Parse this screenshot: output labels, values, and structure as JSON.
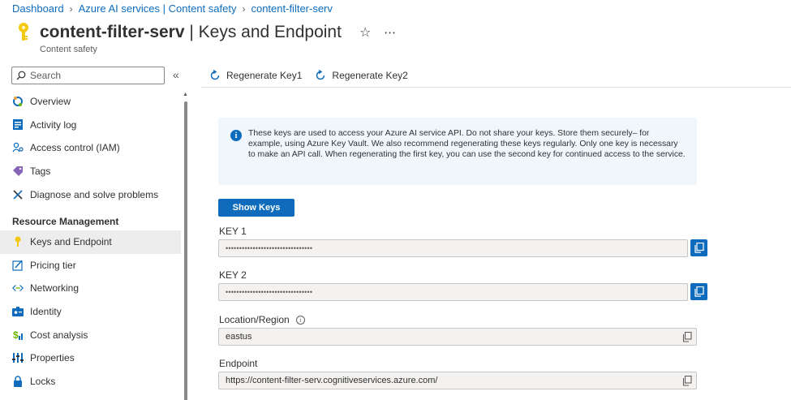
{
  "breadcrumb": {
    "items": [
      "Dashboard",
      "Azure AI services | Content safety",
      "content-filter-serv"
    ]
  },
  "header": {
    "resource_name": "content-filter-serv",
    "title_suffix": " | Keys and Endpoint",
    "subtitle": "Content safety",
    "star_icon": "star-icon",
    "more_icon": "more-icon"
  },
  "search": {
    "placeholder": "Search"
  },
  "sidebar": {
    "items": [
      {
        "label": "Overview",
        "icon": "overview-icon"
      },
      {
        "label": "Activity log",
        "icon": "activity-log-icon"
      },
      {
        "label": "Access control (IAM)",
        "icon": "access-control-icon"
      },
      {
        "label": "Tags",
        "icon": "tag-icon"
      },
      {
        "label": "Diagnose and solve problems",
        "icon": "diagnose-icon"
      }
    ],
    "section_title": "Resource Management",
    "section_items": [
      {
        "label": "Keys and Endpoint",
        "icon": "key-icon",
        "active": true
      },
      {
        "label": "Pricing tier",
        "icon": "pricing-icon"
      },
      {
        "label": "Networking",
        "icon": "networking-icon"
      },
      {
        "label": "Identity",
        "icon": "identity-icon"
      },
      {
        "label": "Cost analysis",
        "icon": "cost-icon"
      },
      {
        "label": "Properties",
        "icon": "properties-icon"
      },
      {
        "label": "Locks",
        "icon": "lock-icon"
      }
    ]
  },
  "toolbar": {
    "regen_key1": "Regenerate Key1",
    "regen_key2": "Regenerate Key2"
  },
  "info": {
    "text": "These keys are used to access your Azure AI service API. Do not share your keys. Store them securely– for example, using Azure Key Vault. We also recommend regenerating these keys regularly. Only one key is necessary to make an API call. When regenerating the first key, you can use the second key for continued access to the service."
  },
  "show_keys_label": "Show Keys",
  "fields": {
    "key1": {
      "label": "KEY 1",
      "value": "••••••••••••••••••••••••••••••••"
    },
    "key2": {
      "label": "KEY 2",
      "value": "••••••••••••••••••••••••••••••••"
    },
    "location": {
      "label": "Location/Region",
      "value": "eastus"
    },
    "endpoint": {
      "label": "Endpoint",
      "value": "https://content-filter-serv.cognitiveservices.azure.com/"
    }
  },
  "colors": {
    "accent": "#0f6cbd",
    "key_yellow": "#f2c811",
    "active_bg": "#ededed",
    "info_bg": "#eff6fc"
  }
}
